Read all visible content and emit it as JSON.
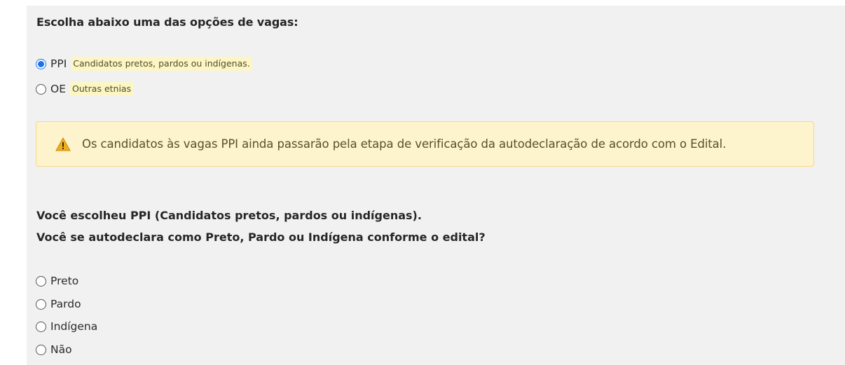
{
  "section_title": "Escolha abaixo uma das opções de vagas:",
  "vacancy_options": [
    {
      "label": "PPI",
      "hint": "Candidatos pretos, pardos ou indígenas.",
      "checked": true
    },
    {
      "label": "OE",
      "hint": "Outras etnias",
      "checked": false
    }
  ],
  "alert": {
    "icon": "warning-icon",
    "text": "Os candidatos às vagas PPI ainda passarão pela etapa de verificação da autodeclaração de acordo com o Edital.",
    "color": "#fdf3cd"
  },
  "question": {
    "line1": "Você escolheu PPI (Candidatos pretos, pardos ou indígenas).",
    "line2": "Você se autodeclara como Preto, Pardo ou Indígena conforme o edital?"
  },
  "self_declaration_options": [
    {
      "label": "Preto",
      "checked": false
    },
    {
      "label": "Pardo",
      "checked": false
    },
    {
      "label": "Indígena",
      "checked": false
    },
    {
      "label": "Não",
      "checked": false
    }
  ],
  "colors": {
    "radio_selected": "#1a73e8",
    "hint_background": "#fdf6c4",
    "panel_background": "#f1f1f1"
  }
}
